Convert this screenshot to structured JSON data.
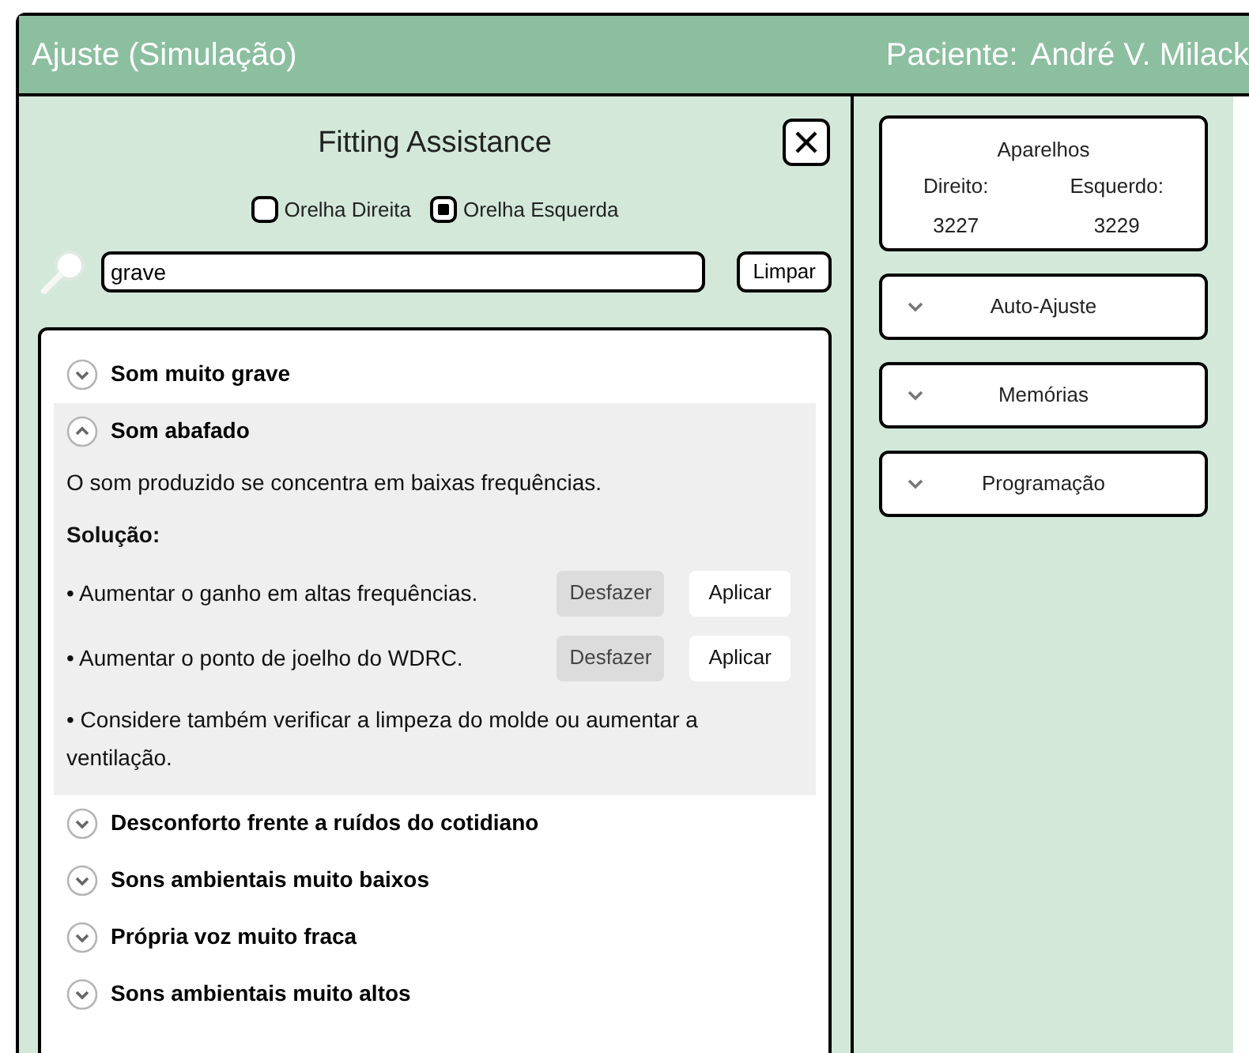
{
  "header": {
    "title": "Ajuste (Simulação)",
    "patient_label": "Paciente:",
    "patient_name": "André V. Milack"
  },
  "assistant": {
    "title": "Fitting Assistance",
    "ears": [
      {
        "label": "Orelha Direita",
        "checked": false
      },
      {
        "label": "Orelha Esquerda",
        "checked": true
      }
    ],
    "search": {
      "value": "grave"
    },
    "clear_button": "Limpar",
    "issues": [
      {
        "title": "Som muito grave",
        "expanded": false
      },
      {
        "title": "Som abafado",
        "expanded": true,
        "description": "O som produzido se concentra em baixas frequências.",
        "solution_label": "Solução:",
        "actions": [
          {
            "text": "• Aumentar o ganho em altas frequências.",
            "undo": "Desfazer",
            "apply": "Aplicar"
          },
          {
            "text": "• Aumentar o ponto de joelho do WDRC.",
            "undo": "Desfazer",
            "apply": "Aplicar"
          }
        ],
        "note": "• Considere também verificar a limpeza do molde ou aumentar a ventilação."
      },
      {
        "title": "Desconforto frente a ruídos do cotidiano",
        "expanded": false
      },
      {
        "title": "Sons ambientais muito baixos",
        "expanded": false
      },
      {
        "title": "Própria voz muito fraca",
        "expanded": false
      },
      {
        "title": "Sons ambientais muito altos",
        "expanded": false
      }
    ]
  },
  "devices": {
    "title": "Aparelhos",
    "columns": [
      {
        "label": "Direito:",
        "value": "3227"
      },
      {
        "label": "Esquerdo:",
        "value": "3229"
      }
    ]
  },
  "sections": [
    {
      "label": "Auto-Ajuste",
      "expanded": false
    },
    {
      "label": "Memórias",
      "expanded": false
    },
    {
      "label": "Programação",
      "expanded": false
    }
  ]
}
